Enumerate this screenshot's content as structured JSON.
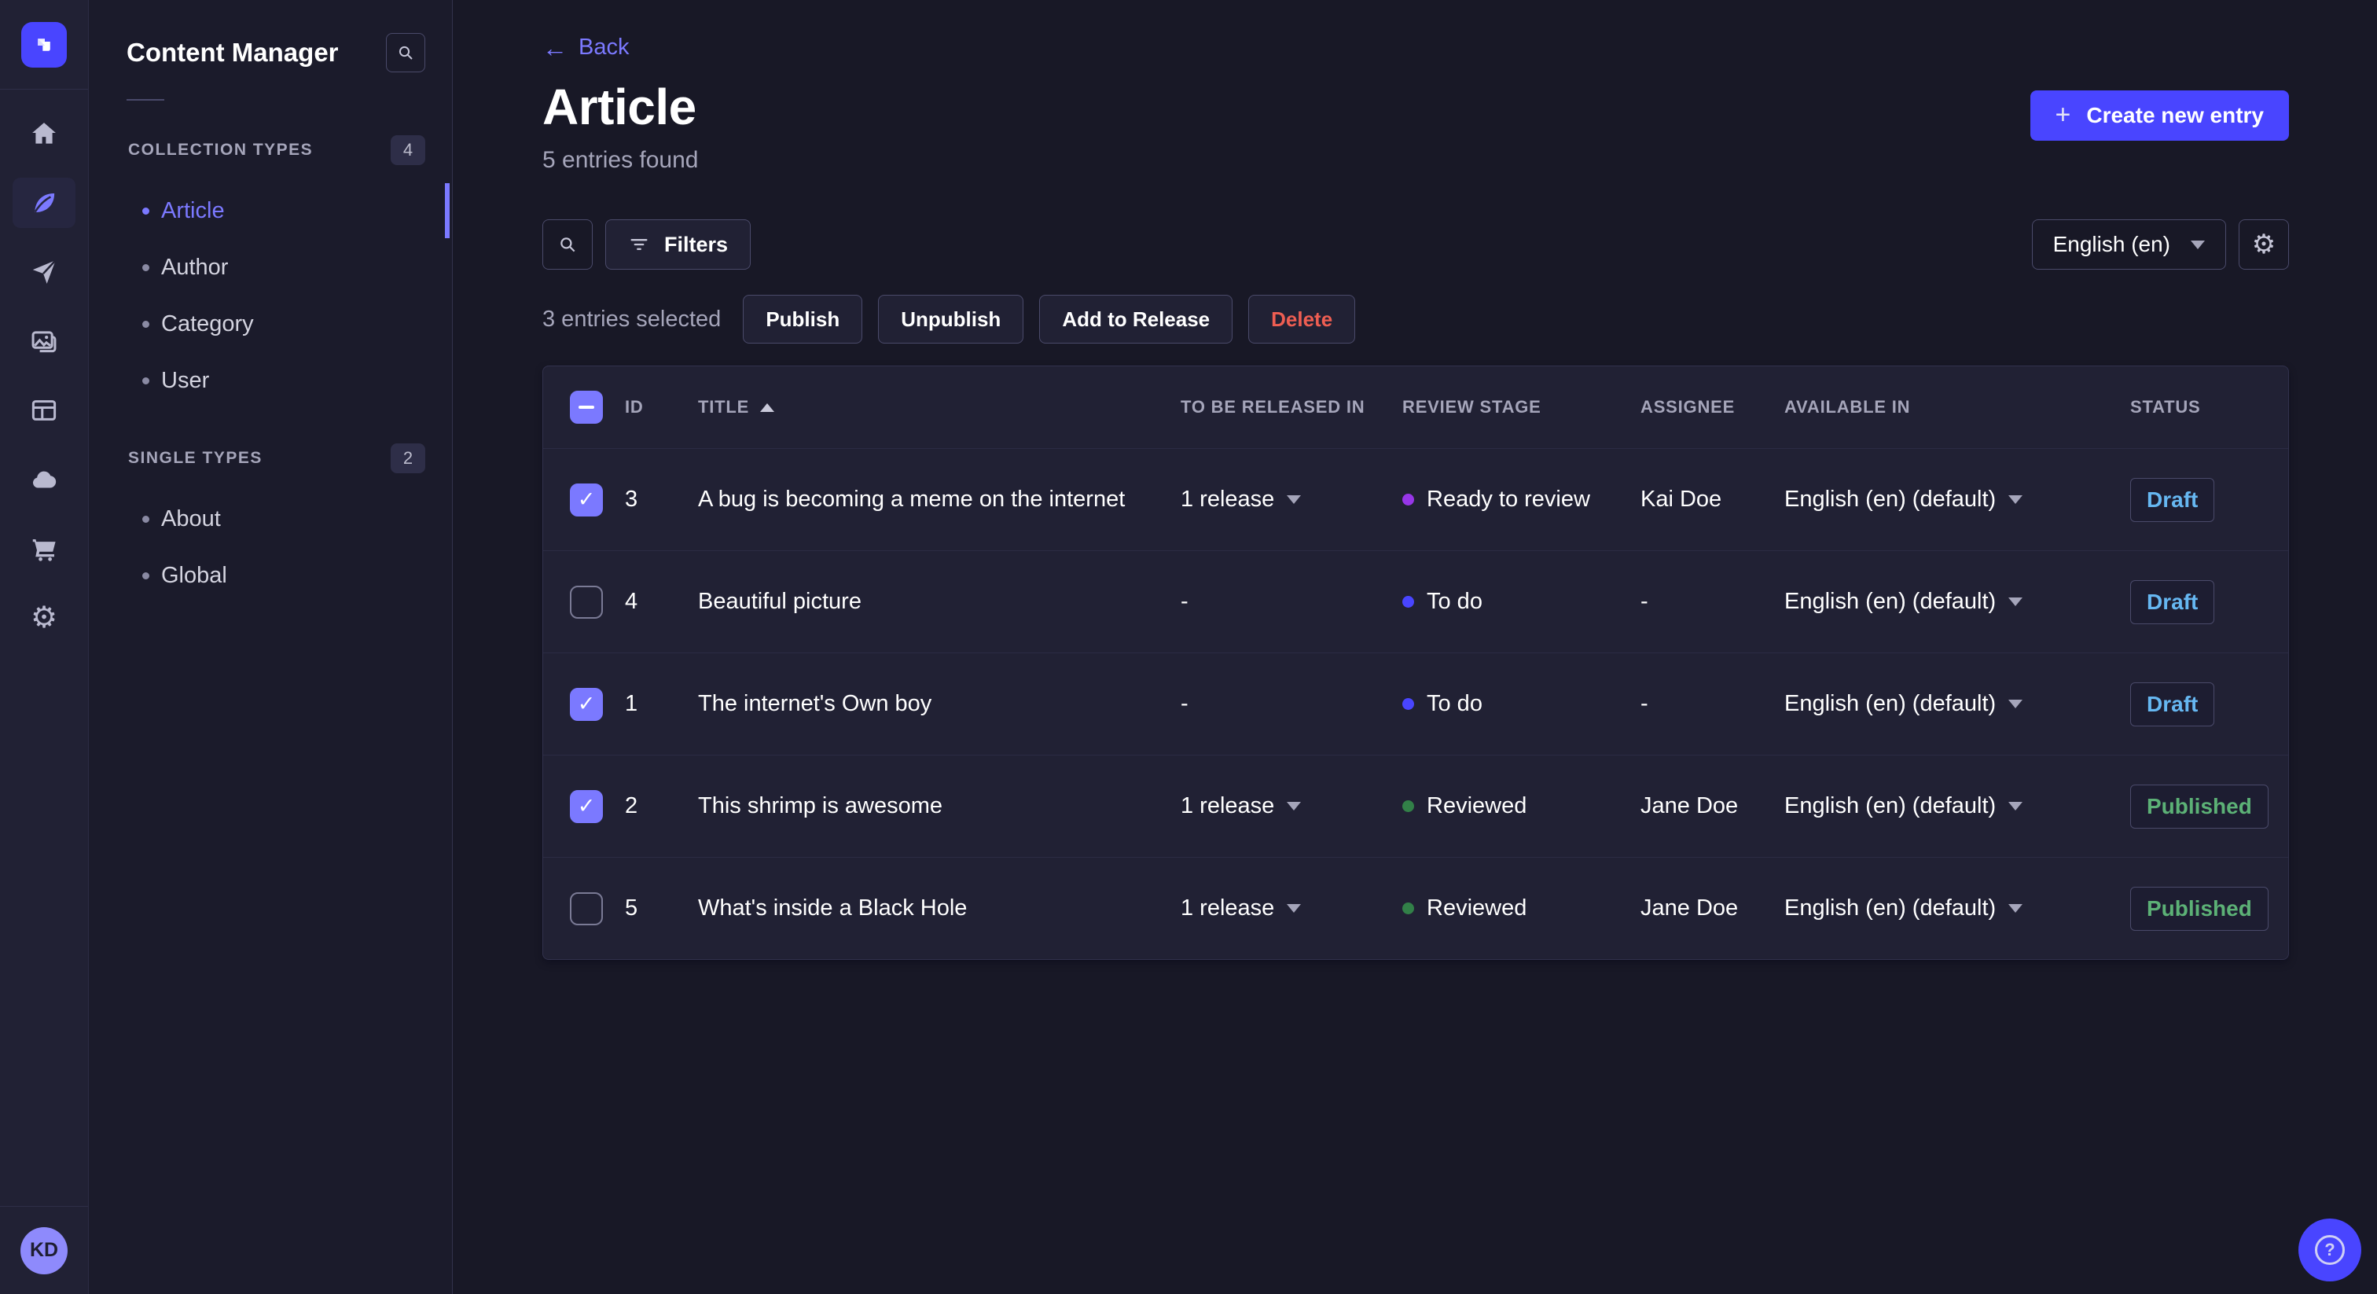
{
  "colors": {
    "primary": "#4945ff",
    "primary_light": "#7b79ff",
    "draft": "#66b7f1",
    "published": "#5cb176",
    "danger": "#ee5e52"
  },
  "main_nav": {
    "icons": [
      {
        "name": "home"
      },
      {
        "name": "content-manager",
        "active": true
      },
      {
        "name": "releases"
      },
      {
        "name": "media-library"
      },
      {
        "name": "content-type-builder"
      },
      {
        "name": "cloud"
      },
      {
        "name": "marketplace"
      },
      {
        "name": "settings"
      }
    ],
    "avatar_initials": "KD"
  },
  "subnav": {
    "title": "Content Manager",
    "sections": [
      {
        "label": "COLLECTION TYPES",
        "count": "4",
        "items": [
          {
            "label": "Article",
            "active": true
          },
          {
            "label": "Author"
          },
          {
            "label": "Category"
          },
          {
            "label": "User"
          }
        ]
      },
      {
        "label": "SINGLE TYPES",
        "count": "2",
        "items": [
          {
            "label": "About"
          },
          {
            "label": "Global"
          }
        ]
      }
    ]
  },
  "page": {
    "back_label": "Back",
    "title": "Article",
    "subtitle": "5 entries found",
    "create_button": "Create new entry"
  },
  "toolbar": {
    "filters_button": "Filters",
    "locale_select": "English (en)"
  },
  "selection": {
    "label": "3 entries selected",
    "publish": "Publish",
    "unpublish": "Unpublish",
    "add_to_release": "Add to Release",
    "delete": "Delete"
  },
  "table": {
    "headers": {
      "id": "ID",
      "title": "TITLE",
      "released": "TO BE RELEASED IN",
      "review": "REVIEW STAGE",
      "assignee": "ASSIGNEE",
      "available": "AVAILABLE IN",
      "status": "STATUS"
    },
    "sort_column": "TITLE",
    "sort_direction": "asc",
    "rows": [
      {
        "checked": true,
        "id": "3",
        "title": "A bug is becoming a meme on the internet",
        "release": "1 release",
        "stage": "Ready to review",
        "stage_color": "#9736e8",
        "assignee": "Kai Doe",
        "locale": "English (en) (default)",
        "status": "Draft",
        "status_color": "#66b7f1"
      },
      {
        "checked": false,
        "id": "4",
        "title": "Beautiful picture",
        "release": "-",
        "stage": "To do",
        "stage_color": "#4945ff",
        "assignee": "-",
        "locale": "English (en) (default)",
        "status": "Draft",
        "status_color": "#66b7f1"
      },
      {
        "checked": true,
        "id": "1",
        "title": "The internet's Own boy",
        "release": "-",
        "stage": "To do",
        "stage_color": "#4945ff",
        "assignee": "-",
        "locale": "English (en) (default)",
        "status": "Draft",
        "status_color": "#66b7f1"
      },
      {
        "checked": true,
        "id": "2",
        "title": "This shrimp is awesome",
        "release": "1 release",
        "stage": "Reviewed",
        "stage_color": "#328048",
        "assignee": "Jane Doe",
        "locale": "English (en) (default)",
        "status": "Published",
        "status_color": "#5cb176"
      },
      {
        "checked": false,
        "id": "5",
        "title": "What's inside a Black Hole",
        "release": "1 release",
        "stage": "Reviewed",
        "stage_color": "#328048",
        "assignee": "Jane Doe",
        "locale": "English (en) (default)",
        "status": "Published",
        "status_color": "#5cb176"
      }
    ]
  }
}
